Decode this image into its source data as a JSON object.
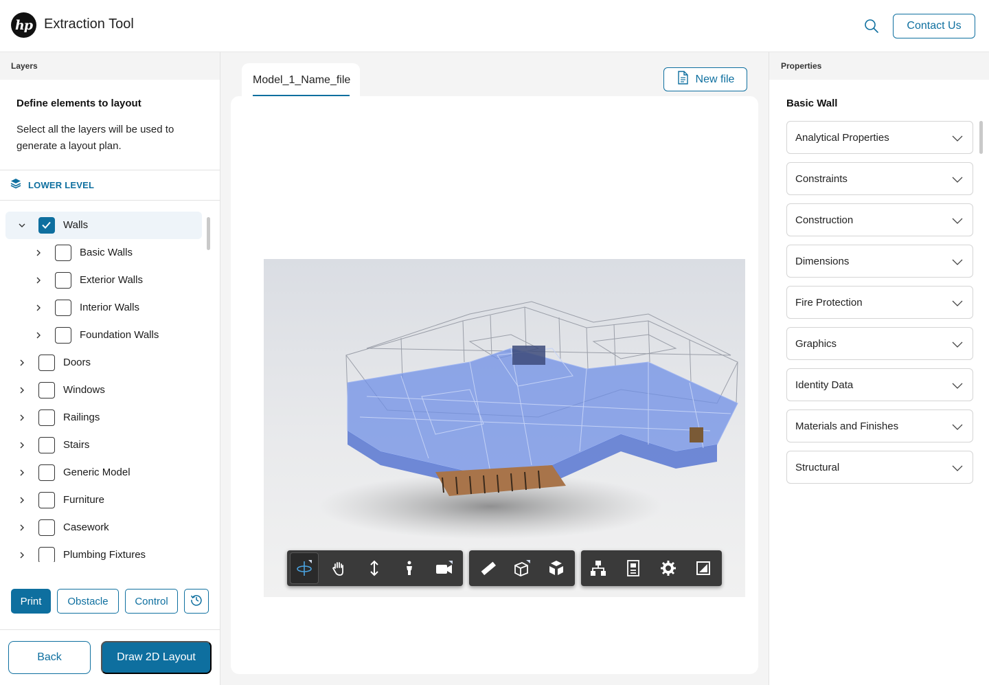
{
  "header": {
    "logo_text": "hp",
    "app_title": "Extraction Tool",
    "contact_label": "Contact Us"
  },
  "left": {
    "panel_title": "Layers",
    "define_title": "Define elements to layout",
    "define_desc": "Select all the layers will be used to generate a layout plan.",
    "level_label": "LOWER LEVEL",
    "tree": {
      "walls": "Walls",
      "basic_walls": "Basic Walls",
      "exterior_walls": "Exterior Walls",
      "interior_walls": "Interior Walls",
      "foundation_walls": "Foundation Walls",
      "doors": "Doors",
      "windows": "Windows",
      "railings": "Railings",
      "stairs": "Stairs",
      "generic_model": "Generic Model",
      "furniture": "Furniture",
      "casework": "Casework",
      "plumbing_fixtures": "Plumbing Fixtures"
    },
    "actions": {
      "print": "Print",
      "obstacle": "Obstacle",
      "control": "Control"
    },
    "back_label": "Back",
    "draw_label": "Draw 2D Layout"
  },
  "center": {
    "file_tab": "Model_1_Name_file",
    "new_file_label": "New file"
  },
  "right": {
    "panel_title": "Properties",
    "element_title": "Basic Wall",
    "properties": [
      "Analytical Properties",
      "Constraints",
      "Construction",
      "Dimensions",
      "Fire Protection",
      "Graphics",
      "Identity Data",
      "Materials and Finishes",
      "Structural"
    ]
  },
  "colors": {
    "accent": "#0e6f9f",
    "panel_bg": "#f4f4f4",
    "selected_row": "#eef4f9"
  },
  "icons": {
    "toolbar": [
      "orbit-icon",
      "pan-hand-icon",
      "zoom-icon",
      "first-person-icon",
      "camera-icon",
      "measure-icon",
      "section-box-icon",
      "explode-icon",
      "model-browser-icon",
      "properties-icon",
      "settings-icon",
      "fullscreen-icon"
    ]
  }
}
